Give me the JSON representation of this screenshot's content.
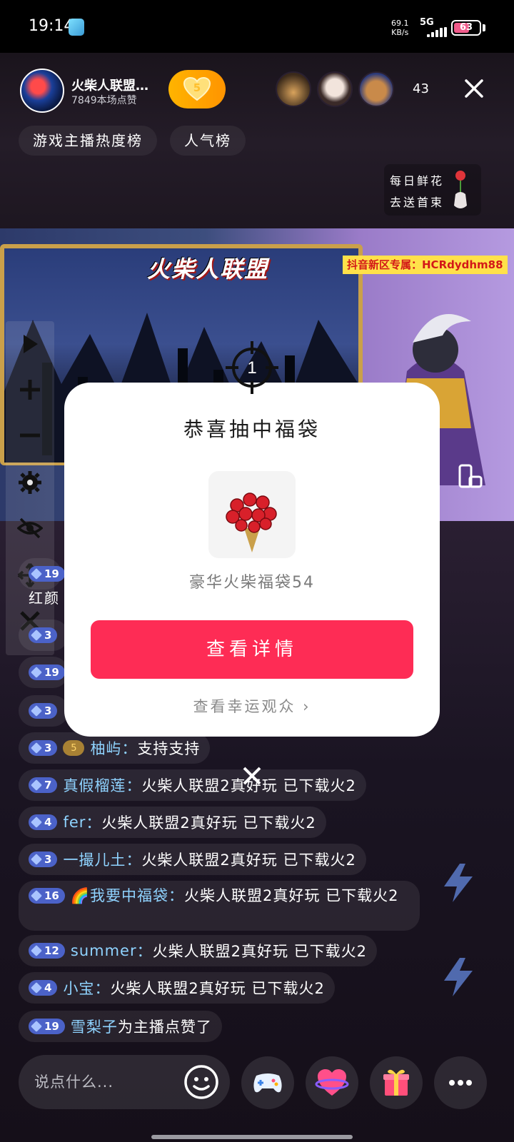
{
  "status_bar": {
    "time": "19:14",
    "speed_value": "69.1",
    "speed_unit": "KB/s",
    "network": "5G",
    "battery": "63",
    "battery_level": 0.63
  },
  "header": {
    "host_name": "火柴人联盟…",
    "host_likes": "7849本场点赞",
    "fan_badge_level": "5",
    "viewer_count": "43"
  },
  "rank_tags": [
    "游戏主播热度榜",
    "人气榜"
  ],
  "flower_promo": {
    "line1": "每日鲜花",
    "line2": "去送首束"
  },
  "stream": {
    "game_logo": "火柴人联盟",
    "promo_banner": "抖音新区专属：HCRdydhm88"
  },
  "chat": {
    "partial_name": "红颜",
    "messages": [
      {
        "level": "3",
        "fan": "5",
        "user": "柚屿",
        "sep": "：",
        "text": "支持支持"
      },
      {
        "level": "7",
        "user": "真假榴莲",
        "sep": "：",
        "text": "火柴人联盟2真好玩 已下载火2"
      },
      {
        "level": "4",
        "user": "fer",
        "sep": "：",
        "text": "火柴人联盟2真好玩 已下载火2"
      },
      {
        "level": "3",
        "user": "一撮儿土",
        "sep": "：",
        "text": "火柴人联盟2真好玩 已下载火2"
      },
      {
        "level": "16",
        "user": "🌈我要中福袋",
        "sep": "：",
        "text": "火柴人联盟2真好玩 已下载火2"
      },
      {
        "level": "12",
        "user": "summer",
        "sep": "：",
        "text": "火柴人联盟2真好玩 已下载火2"
      },
      {
        "level": "4",
        "user": "小宝",
        "sep": "：",
        "text": "火柴人联盟2真好玩 已下载火2"
      },
      {
        "level": "19",
        "user": "雪梨子",
        "sep": " ",
        "text": "为主播点赞了"
      }
    ],
    "hidden_levels": [
      "19",
      "3",
      "19",
      "3"
    ]
  },
  "modal": {
    "title": "恭喜抽中福袋",
    "prize_name": "豪华火柴福袋54",
    "detail_button": "查看详情",
    "lucky_link": "查看幸运观众",
    "lucky_link_chevron": "›"
  },
  "crosshair_label": "1",
  "bottom_bar": {
    "comment_placeholder": "说点什么..."
  },
  "colors": {
    "primary_button": "#fe2c55",
    "follow_gradient_start": "#ffb400",
    "username": "#8fd3ff",
    "level_badge": "#4b62c8"
  },
  "icons": {
    "toolbar": [
      "play-icon",
      "plus-icon",
      "minus-icon",
      "gear-icon",
      "eye-off-icon",
      "move-icon",
      "close-icon"
    ],
    "bottom": [
      "emoji-icon",
      "gamepad-icon",
      "heart-planet-icon",
      "gift-icon",
      "more-icon"
    ]
  }
}
